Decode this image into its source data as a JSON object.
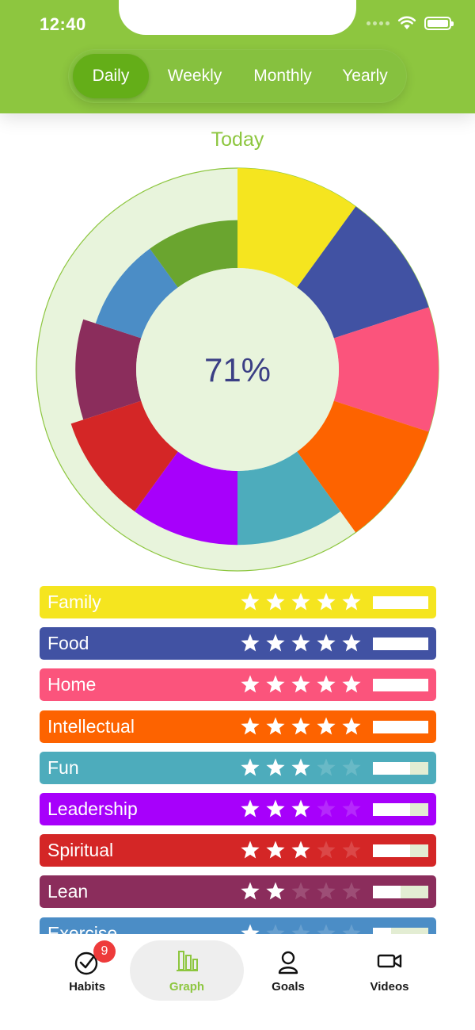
{
  "status_bar": {
    "time": "12:40"
  },
  "segments": [
    {
      "label": "Daily",
      "active": true
    },
    {
      "label": "Weekly",
      "active": false
    },
    {
      "label": "Monthly",
      "active": false
    },
    {
      "label": "Yearly",
      "active": false
    }
  ],
  "period_title": "Today",
  "overall_percent": "71%",
  "categories": [
    {
      "label": "Family",
      "color": "#f5e51f",
      "rating": 5,
      "progress": 1.0
    },
    {
      "label": "Food",
      "color": "#4152a3",
      "rating": 5,
      "progress": 1.0
    },
    {
      "label": "Home",
      "color": "#fb547c",
      "rating": 5,
      "progress": 1.0
    },
    {
      "label": "Intellectual",
      "color": "#fd6300",
      "rating": 5,
      "progress": 1.0
    },
    {
      "label": "Fun",
      "color": "#4dacbc",
      "rating": 3,
      "progress": 0.67
    },
    {
      "label": "Leadership",
      "color": "#a700fb",
      "rating": 3,
      "progress": 0.67
    },
    {
      "label": "Spiritual",
      "color": "#d42626",
      "rating": 3,
      "progress": 0.67
    },
    {
      "label": "Lean",
      "color": "#8b2d5c",
      "rating": 2,
      "progress": 0.5
    },
    {
      "label": "Exercise",
      "color": "#4b8dc6",
      "rating": 1,
      "progress": 0.33
    },
    {
      "label": "",
      "color": "#6aa52f",
      "rating": 1,
      "progress": 0.33
    }
  ],
  "tabs": [
    {
      "label": "Habits",
      "icon": "habits-check-icon",
      "badge": "9",
      "active": false
    },
    {
      "label": "Graph",
      "icon": "graph-bars-icon",
      "active": true
    },
    {
      "label": "Goals",
      "icon": "goals-person-icon",
      "active": false
    },
    {
      "label": "Videos",
      "icon": "videos-camera-icon",
      "active": false
    }
  ],
  "colors": {
    "header_green": "#8dc63f",
    "active_segment": "#64ae18",
    "chart_background": "#e8f4dc",
    "center_text": "#3b3f85"
  }
}
